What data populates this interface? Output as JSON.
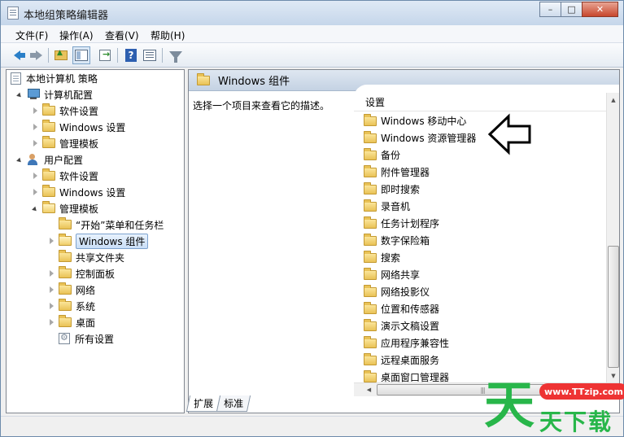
{
  "window": {
    "title": "本地组策略编辑器",
    "minimize": "–",
    "maximize": "□",
    "close": "✕"
  },
  "menu": [
    "文件(F)",
    "操作(A)",
    "查看(V)",
    "帮助(H)"
  ],
  "toolbar": {
    "icons": [
      "back-arrow-icon",
      "forward-arrow-icon",
      "up-folder-icon",
      "show-tree-icon",
      "export-list-icon",
      "help-icon",
      "properties-icon",
      "filter-icon"
    ],
    "help_glyph": "?"
  },
  "tree": {
    "root": "本地计算机 策略",
    "computer": "计算机配置",
    "computer_children": [
      "软件设置",
      "Windows 设置",
      "管理模板"
    ],
    "user": "用户配置",
    "user_children": [
      "软件设置",
      "Windows 设置",
      "管理模板"
    ],
    "admin_templates_children": [
      "“开始”菜单和任务栏",
      "Windows 组件",
      "共享文件夹",
      "控制面板",
      "网络",
      "系统",
      "桌面",
      "所有设置"
    ],
    "selected": "Windows 组件"
  },
  "right_pane": {
    "header": "Windows 组件",
    "description": "选择一个项目来查看它的描述。",
    "column_header": "设置",
    "items": [
      "Windows 移动中心",
      "Windows 资源管理器",
      "备份",
      "附件管理器",
      "即时搜索",
      "录音机",
      "任务计划程序",
      "数字保险箱",
      "搜索",
      "网络共享",
      "网络投影仪",
      "位置和传感器",
      "演示文稿设置",
      "应用程序兼容性",
      "远程桌面服务",
      "桌面窗口管理器"
    ]
  },
  "scrollbars": {
    "up": "▲",
    "down": "▼",
    "left": "◀",
    "right": "▶",
    "grip": "|||"
  },
  "tabs": [
    "扩展",
    "标准"
  ],
  "watermark": {
    "big_char": "天",
    "url": "www.TTzip.com",
    "text": "天下载"
  }
}
